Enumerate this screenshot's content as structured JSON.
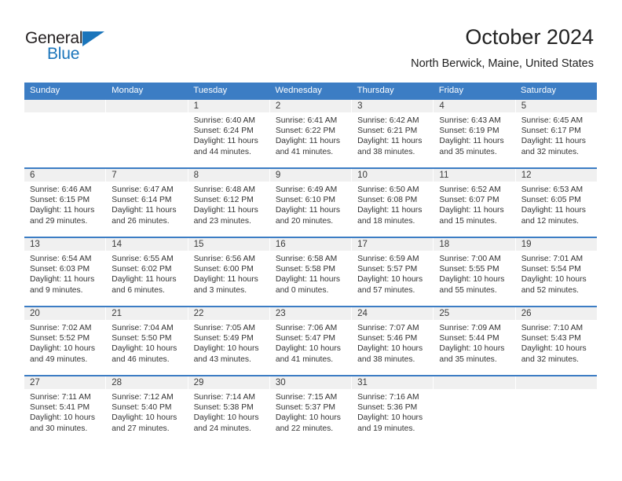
{
  "brand": {
    "name_part1": "General",
    "name_part2": "Blue",
    "accent_color": "#1b75bb"
  },
  "header": {
    "title": "October 2024",
    "subtitle": "North Berwick, Maine, United States"
  },
  "theme": {
    "header_blue": "#3c7dc4",
    "day_band_gray": "#f0f0f0",
    "text_color": "#333333"
  },
  "weekdays": [
    "Sunday",
    "Monday",
    "Tuesday",
    "Wednesday",
    "Thursday",
    "Friday",
    "Saturday"
  ],
  "labels": {
    "sunrise_prefix": "Sunrise:",
    "sunset_prefix": "Sunset:",
    "daylight_prefix": "Daylight:"
  },
  "weeks": [
    [
      {
        "empty": true
      },
      {
        "empty": true
      },
      {
        "day": "1",
        "sunrise": "Sunrise: 6:40 AM",
        "sunset": "Sunset: 6:24 PM",
        "daylight": "Daylight: 11 hours and 44 minutes."
      },
      {
        "day": "2",
        "sunrise": "Sunrise: 6:41 AM",
        "sunset": "Sunset: 6:22 PM",
        "daylight": "Daylight: 11 hours and 41 minutes."
      },
      {
        "day": "3",
        "sunrise": "Sunrise: 6:42 AM",
        "sunset": "Sunset: 6:21 PM",
        "daylight": "Daylight: 11 hours and 38 minutes."
      },
      {
        "day": "4",
        "sunrise": "Sunrise: 6:43 AM",
        "sunset": "Sunset: 6:19 PM",
        "daylight": "Daylight: 11 hours and 35 minutes."
      },
      {
        "day": "5",
        "sunrise": "Sunrise: 6:45 AM",
        "sunset": "Sunset: 6:17 PM",
        "daylight": "Daylight: 11 hours and 32 minutes."
      }
    ],
    [
      {
        "day": "6",
        "sunrise": "Sunrise: 6:46 AM",
        "sunset": "Sunset: 6:15 PM",
        "daylight": "Daylight: 11 hours and 29 minutes."
      },
      {
        "day": "7",
        "sunrise": "Sunrise: 6:47 AM",
        "sunset": "Sunset: 6:14 PM",
        "daylight": "Daylight: 11 hours and 26 minutes."
      },
      {
        "day": "8",
        "sunrise": "Sunrise: 6:48 AM",
        "sunset": "Sunset: 6:12 PM",
        "daylight": "Daylight: 11 hours and 23 minutes."
      },
      {
        "day": "9",
        "sunrise": "Sunrise: 6:49 AM",
        "sunset": "Sunset: 6:10 PM",
        "daylight": "Daylight: 11 hours and 20 minutes."
      },
      {
        "day": "10",
        "sunrise": "Sunrise: 6:50 AM",
        "sunset": "Sunset: 6:08 PM",
        "daylight": "Daylight: 11 hours and 18 minutes."
      },
      {
        "day": "11",
        "sunrise": "Sunrise: 6:52 AM",
        "sunset": "Sunset: 6:07 PM",
        "daylight": "Daylight: 11 hours and 15 minutes."
      },
      {
        "day": "12",
        "sunrise": "Sunrise: 6:53 AM",
        "sunset": "Sunset: 6:05 PM",
        "daylight": "Daylight: 11 hours and 12 minutes."
      }
    ],
    [
      {
        "day": "13",
        "sunrise": "Sunrise: 6:54 AM",
        "sunset": "Sunset: 6:03 PM",
        "daylight": "Daylight: 11 hours and 9 minutes."
      },
      {
        "day": "14",
        "sunrise": "Sunrise: 6:55 AM",
        "sunset": "Sunset: 6:02 PM",
        "daylight": "Daylight: 11 hours and 6 minutes."
      },
      {
        "day": "15",
        "sunrise": "Sunrise: 6:56 AM",
        "sunset": "Sunset: 6:00 PM",
        "daylight": "Daylight: 11 hours and 3 minutes."
      },
      {
        "day": "16",
        "sunrise": "Sunrise: 6:58 AM",
        "sunset": "Sunset: 5:58 PM",
        "daylight": "Daylight: 11 hours and 0 minutes."
      },
      {
        "day": "17",
        "sunrise": "Sunrise: 6:59 AM",
        "sunset": "Sunset: 5:57 PM",
        "daylight": "Daylight: 10 hours and 57 minutes."
      },
      {
        "day": "18",
        "sunrise": "Sunrise: 7:00 AM",
        "sunset": "Sunset: 5:55 PM",
        "daylight": "Daylight: 10 hours and 55 minutes."
      },
      {
        "day": "19",
        "sunrise": "Sunrise: 7:01 AM",
        "sunset": "Sunset: 5:54 PM",
        "daylight": "Daylight: 10 hours and 52 minutes."
      }
    ],
    [
      {
        "day": "20",
        "sunrise": "Sunrise: 7:02 AM",
        "sunset": "Sunset: 5:52 PM",
        "daylight": "Daylight: 10 hours and 49 minutes."
      },
      {
        "day": "21",
        "sunrise": "Sunrise: 7:04 AM",
        "sunset": "Sunset: 5:50 PM",
        "daylight": "Daylight: 10 hours and 46 minutes."
      },
      {
        "day": "22",
        "sunrise": "Sunrise: 7:05 AM",
        "sunset": "Sunset: 5:49 PM",
        "daylight": "Daylight: 10 hours and 43 minutes."
      },
      {
        "day": "23",
        "sunrise": "Sunrise: 7:06 AM",
        "sunset": "Sunset: 5:47 PM",
        "daylight": "Daylight: 10 hours and 41 minutes."
      },
      {
        "day": "24",
        "sunrise": "Sunrise: 7:07 AM",
        "sunset": "Sunset: 5:46 PM",
        "daylight": "Daylight: 10 hours and 38 minutes."
      },
      {
        "day": "25",
        "sunrise": "Sunrise: 7:09 AM",
        "sunset": "Sunset: 5:44 PM",
        "daylight": "Daylight: 10 hours and 35 minutes."
      },
      {
        "day": "26",
        "sunrise": "Sunrise: 7:10 AM",
        "sunset": "Sunset: 5:43 PM",
        "daylight": "Daylight: 10 hours and 32 minutes."
      }
    ],
    [
      {
        "day": "27",
        "sunrise": "Sunrise: 7:11 AM",
        "sunset": "Sunset: 5:41 PM",
        "daylight": "Daylight: 10 hours and 30 minutes."
      },
      {
        "day": "28",
        "sunrise": "Sunrise: 7:12 AM",
        "sunset": "Sunset: 5:40 PM",
        "daylight": "Daylight: 10 hours and 27 minutes."
      },
      {
        "day": "29",
        "sunrise": "Sunrise: 7:14 AM",
        "sunset": "Sunset: 5:38 PM",
        "daylight": "Daylight: 10 hours and 24 minutes."
      },
      {
        "day": "30",
        "sunrise": "Sunrise: 7:15 AM",
        "sunset": "Sunset: 5:37 PM",
        "daylight": "Daylight: 10 hours and 22 minutes."
      },
      {
        "day": "31",
        "sunrise": "Sunrise: 7:16 AM",
        "sunset": "Sunset: 5:36 PM",
        "daylight": "Daylight: 10 hours and 19 minutes."
      },
      {
        "empty": true
      },
      {
        "empty": true
      }
    ]
  ]
}
